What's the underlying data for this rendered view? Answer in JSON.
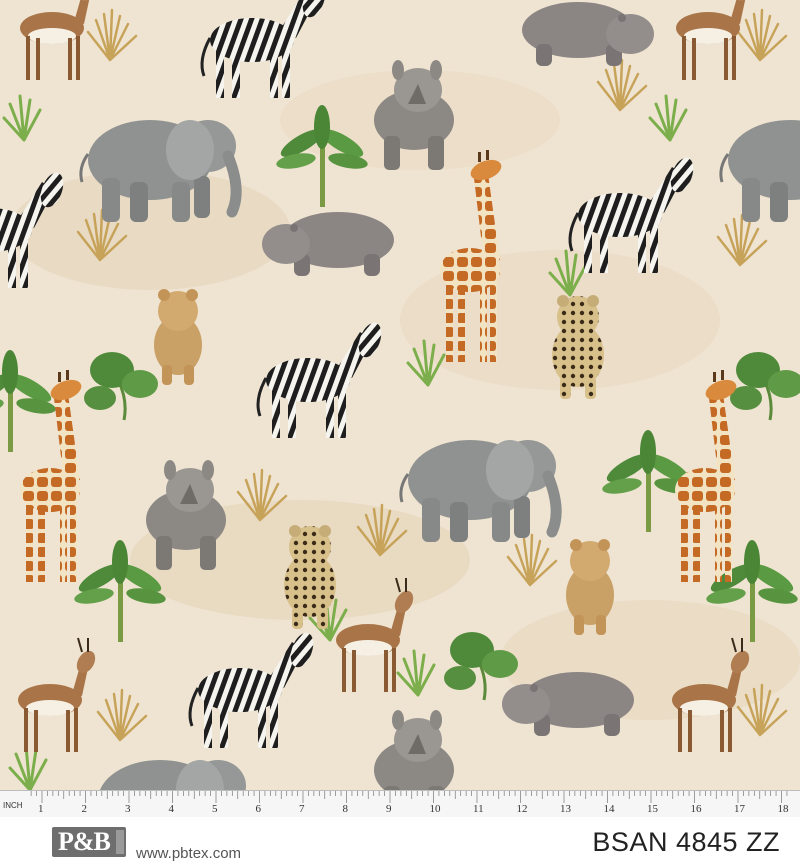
{
  "swatch": {
    "background": "#efe4d2",
    "pattern_description_icons": [
      "zebra-icon",
      "elephant-icon",
      "giraffe-icon",
      "rhino-icon",
      "hippo-icon",
      "lion-cub-icon",
      "leopard-cub-icon",
      "gazelle-icon",
      "grass-tuft-icon",
      "palm-sprout-icon",
      "monstera-leaf-icon"
    ]
  },
  "ruler": {
    "unit_label": "INCH",
    "ticks": [
      "1",
      "2",
      "3",
      "4",
      "5",
      "6",
      "7",
      "8",
      "9",
      "10",
      "11",
      "12",
      "13",
      "14",
      "15",
      "16",
      "17",
      "18"
    ]
  },
  "footer": {
    "brand": "P&B",
    "website": "www.pbtex.com",
    "product_code": "BSAN 4845 ZZ",
    "logo_color": "#6e6e6e"
  }
}
